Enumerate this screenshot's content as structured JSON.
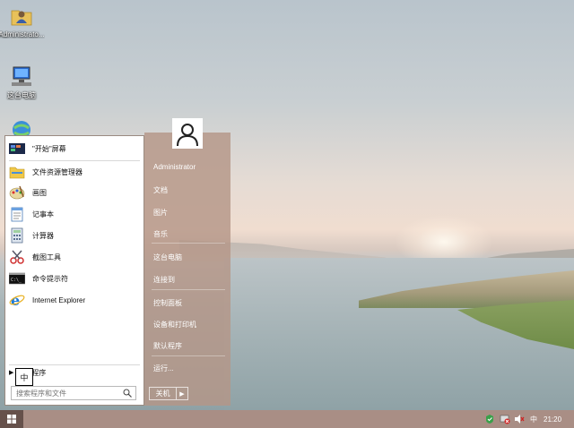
{
  "desktop": {
    "icons": [
      {
        "label": "Administrato...",
        "icon": "user-folder-icon"
      },
      {
        "label": "这台电脑",
        "icon": "computer-icon"
      },
      {
        "label": "",
        "icon": "network-icon"
      }
    ]
  },
  "start_menu": {
    "pinned": [
      {
        "label": "\"开始\"屏幕",
        "icon": "start-screen-icon"
      },
      {
        "label": "文件资源管理器",
        "icon": "file-explorer-icon"
      },
      {
        "label": "画图",
        "icon": "paint-icon"
      },
      {
        "label": "记事本",
        "icon": "notepad-icon"
      },
      {
        "label": "计算器",
        "icon": "calculator-icon"
      },
      {
        "label": "截图工具",
        "icon": "snipping-tool-icon"
      },
      {
        "label": "命令提示符",
        "icon": "cmd-icon"
      },
      {
        "label": "Internet Explorer",
        "icon": "ie-icon"
      }
    ],
    "all_programs_label": "所有程序",
    "search_placeholder": "搜索程序和文件",
    "ime_indicator": "中",
    "user_name": "Administrator",
    "right_items": [
      "文档",
      "图片",
      "音乐",
      "这台电脑",
      "连接到",
      "控制面板",
      "设备和打印机",
      "默认程序",
      "运行..."
    ],
    "shutdown_label": "关机"
  },
  "taskbar": {
    "start_icon": "windows-logo-icon",
    "tray": {
      "ime": "中",
      "time": "21:20"
    }
  }
}
